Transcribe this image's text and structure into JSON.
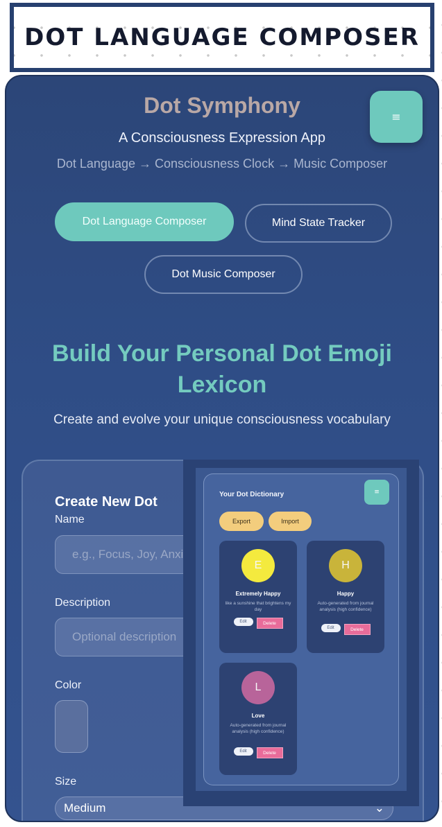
{
  "banner": {
    "title": "DOT LANGUAGE COMPOSER"
  },
  "header": {
    "app_title": "Dot Symphony",
    "subtitle": "A Consciousness Expression App",
    "flow": "Dot Language → Consciousness Clock → Music Composer",
    "menu_icon": "≡"
  },
  "tabs": [
    {
      "label": "Dot Language Composer",
      "active": true
    },
    {
      "label": "Mind State Tracker",
      "active": false
    },
    {
      "label": "Dot Music Composer",
      "active": false
    }
  ],
  "hero": {
    "title": "Build Your Personal Dot Emoji Lexicon",
    "subtitle": "Create and evolve your unique consciousness vocabulary"
  },
  "create_form": {
    "title": "Create New Dot",
    "name_label": "Name",
    "name_placeholder": "e.g., Focus, Joy, Anxiety",
    "description_label": "Description",
    "description_placeholder": "Optional description",
    "color_label": "Color",
    "color_value": "#5a6f9e",
    "size_label": "Size",
    "size_value": "Medium",
    "size_chevron": "⌄"
  },
  "dictionary": {
    "title": "Your Dot Dictionary",
    "menu_icon": "≡",
    "export_label": "Export",
    "import_label": "Import",
    "edit_label": "Edit",
    "delete_label": "Delete",
    "entries": [
      {
        "letter": "E",
        "name": "Extremely Happy",
        "description": "like a sunshine that brightens my day",
        "color": "#f4ea3e"
      },
      {
        "letter": "H",
        "name": "Happy",
        "description": "Auto-generated from journal analysis (high confidence)",
        "color": "#c9b43a"
      },
      {
        "letter": "L",
        "name": "Love",
        "description": "Auto-generated from journal analysis (high confidence)",
        "color": "#b8649a"
      }
    ]
  }
}
